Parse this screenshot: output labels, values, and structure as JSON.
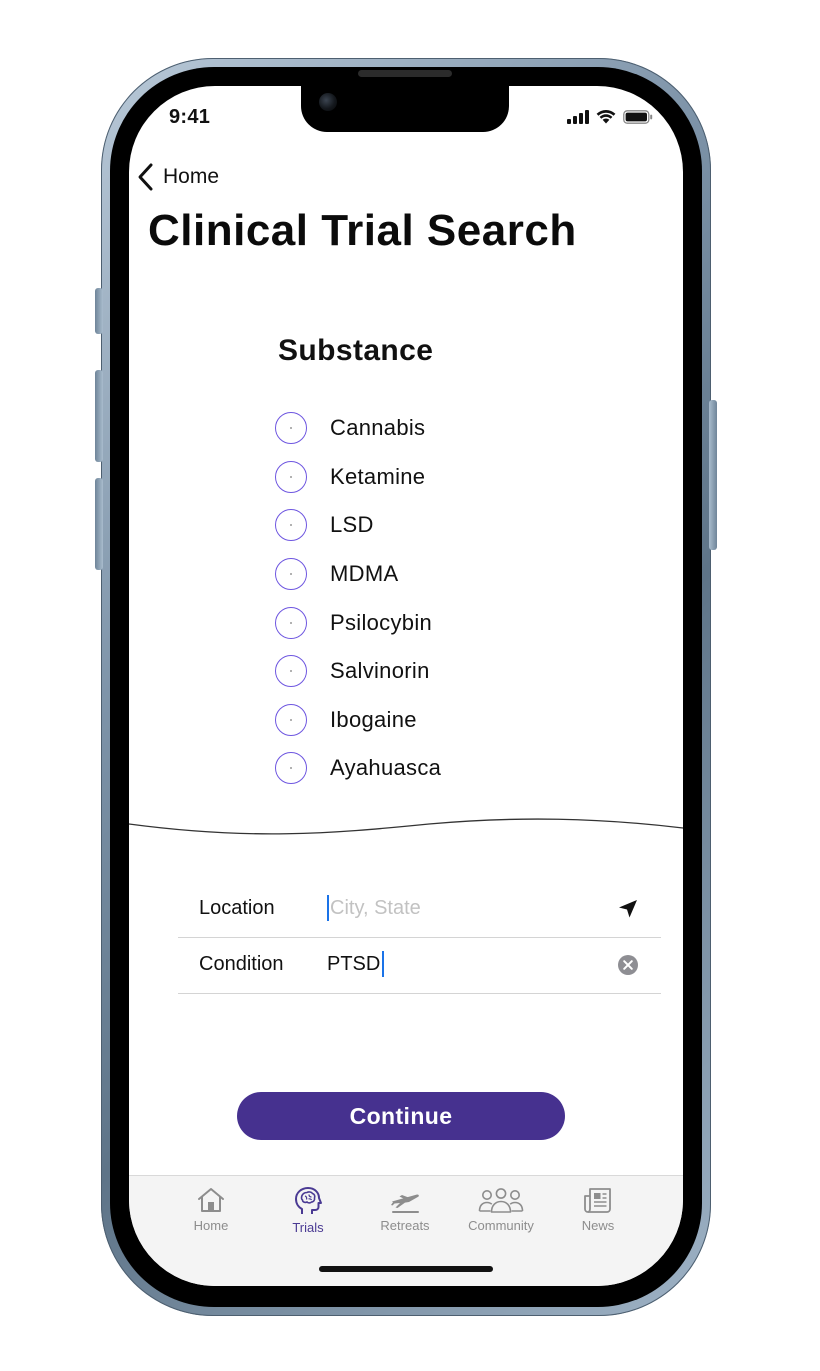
{
  "status_bar": {
    "time": "9:41",
    "icons": [
      "cellular-signal-icon",
      "wifi-icon",
      "battery-icon"
    ]
  },
  "nav": {
    "back_label": "Home",
    "back_icon": "chevron-left-icon"
  },
  "page": {
    "title": "Clinical Trial Search"
  },
  "substance": {
    "heading": "Substance",
    "options": [
      {
        "label": "Cannabis",
        "selected": false
      },
      {
        "label": "Ketamine",
        "selected": false
      },
      {
        "label": "LSD",
        "selected": false
      },
      {
        "label": "MDMA",
        "selected": false
      },
      {
        "label": "Psilocybin",
        "selected": false
      },
      {
        "label": "Salvinorin",
        "selected": false
      },
      {
        "label": "Ibogaine",
        "selected": false
      },
      {
        "label": "Ayahuasca",
        "selected": false
      }
    ]
  },
  "form": {
    "location": {
      "label": "Location",
      "placeholder": "City, State",
      "value": "",
      "icon": "location-arrow-icon"
    },
    "condition": {
      "label": "Condition",
      "value": "PTSD",
      "icon": "clear-circle-icon"
    }
  },
  "continue_button": {
    "label": "Continue"
  },
  "tab_bar": {
    "tabs": [
      {
        "label": "Home",
        "icon": "house-icon",
        "active": false
      },
      {
        "label": "Trials",
        "icon": "brain-head-icon",
        "active": true
      },
      {
        "label": "Retreats",
        "icon": "airplane-icon",
        "active": false
      },
      {
        "label": "Community",
        "icon": "people-group-icon",
        "active": false
      },
      {
        "label": "News",
        "icon": "newspaper-icon",
        "active": false
      }
    ]
  },
  "colors": {
    "accent": "#46318f",
    "radio_border": "#6e56e0",
    "active_tab": "#4a3a93",
    "inactive_tab": "#8d8d8d",
    "caret": "#1a73e8",
    "phone_frame": "#7d93a8"
  }
}
